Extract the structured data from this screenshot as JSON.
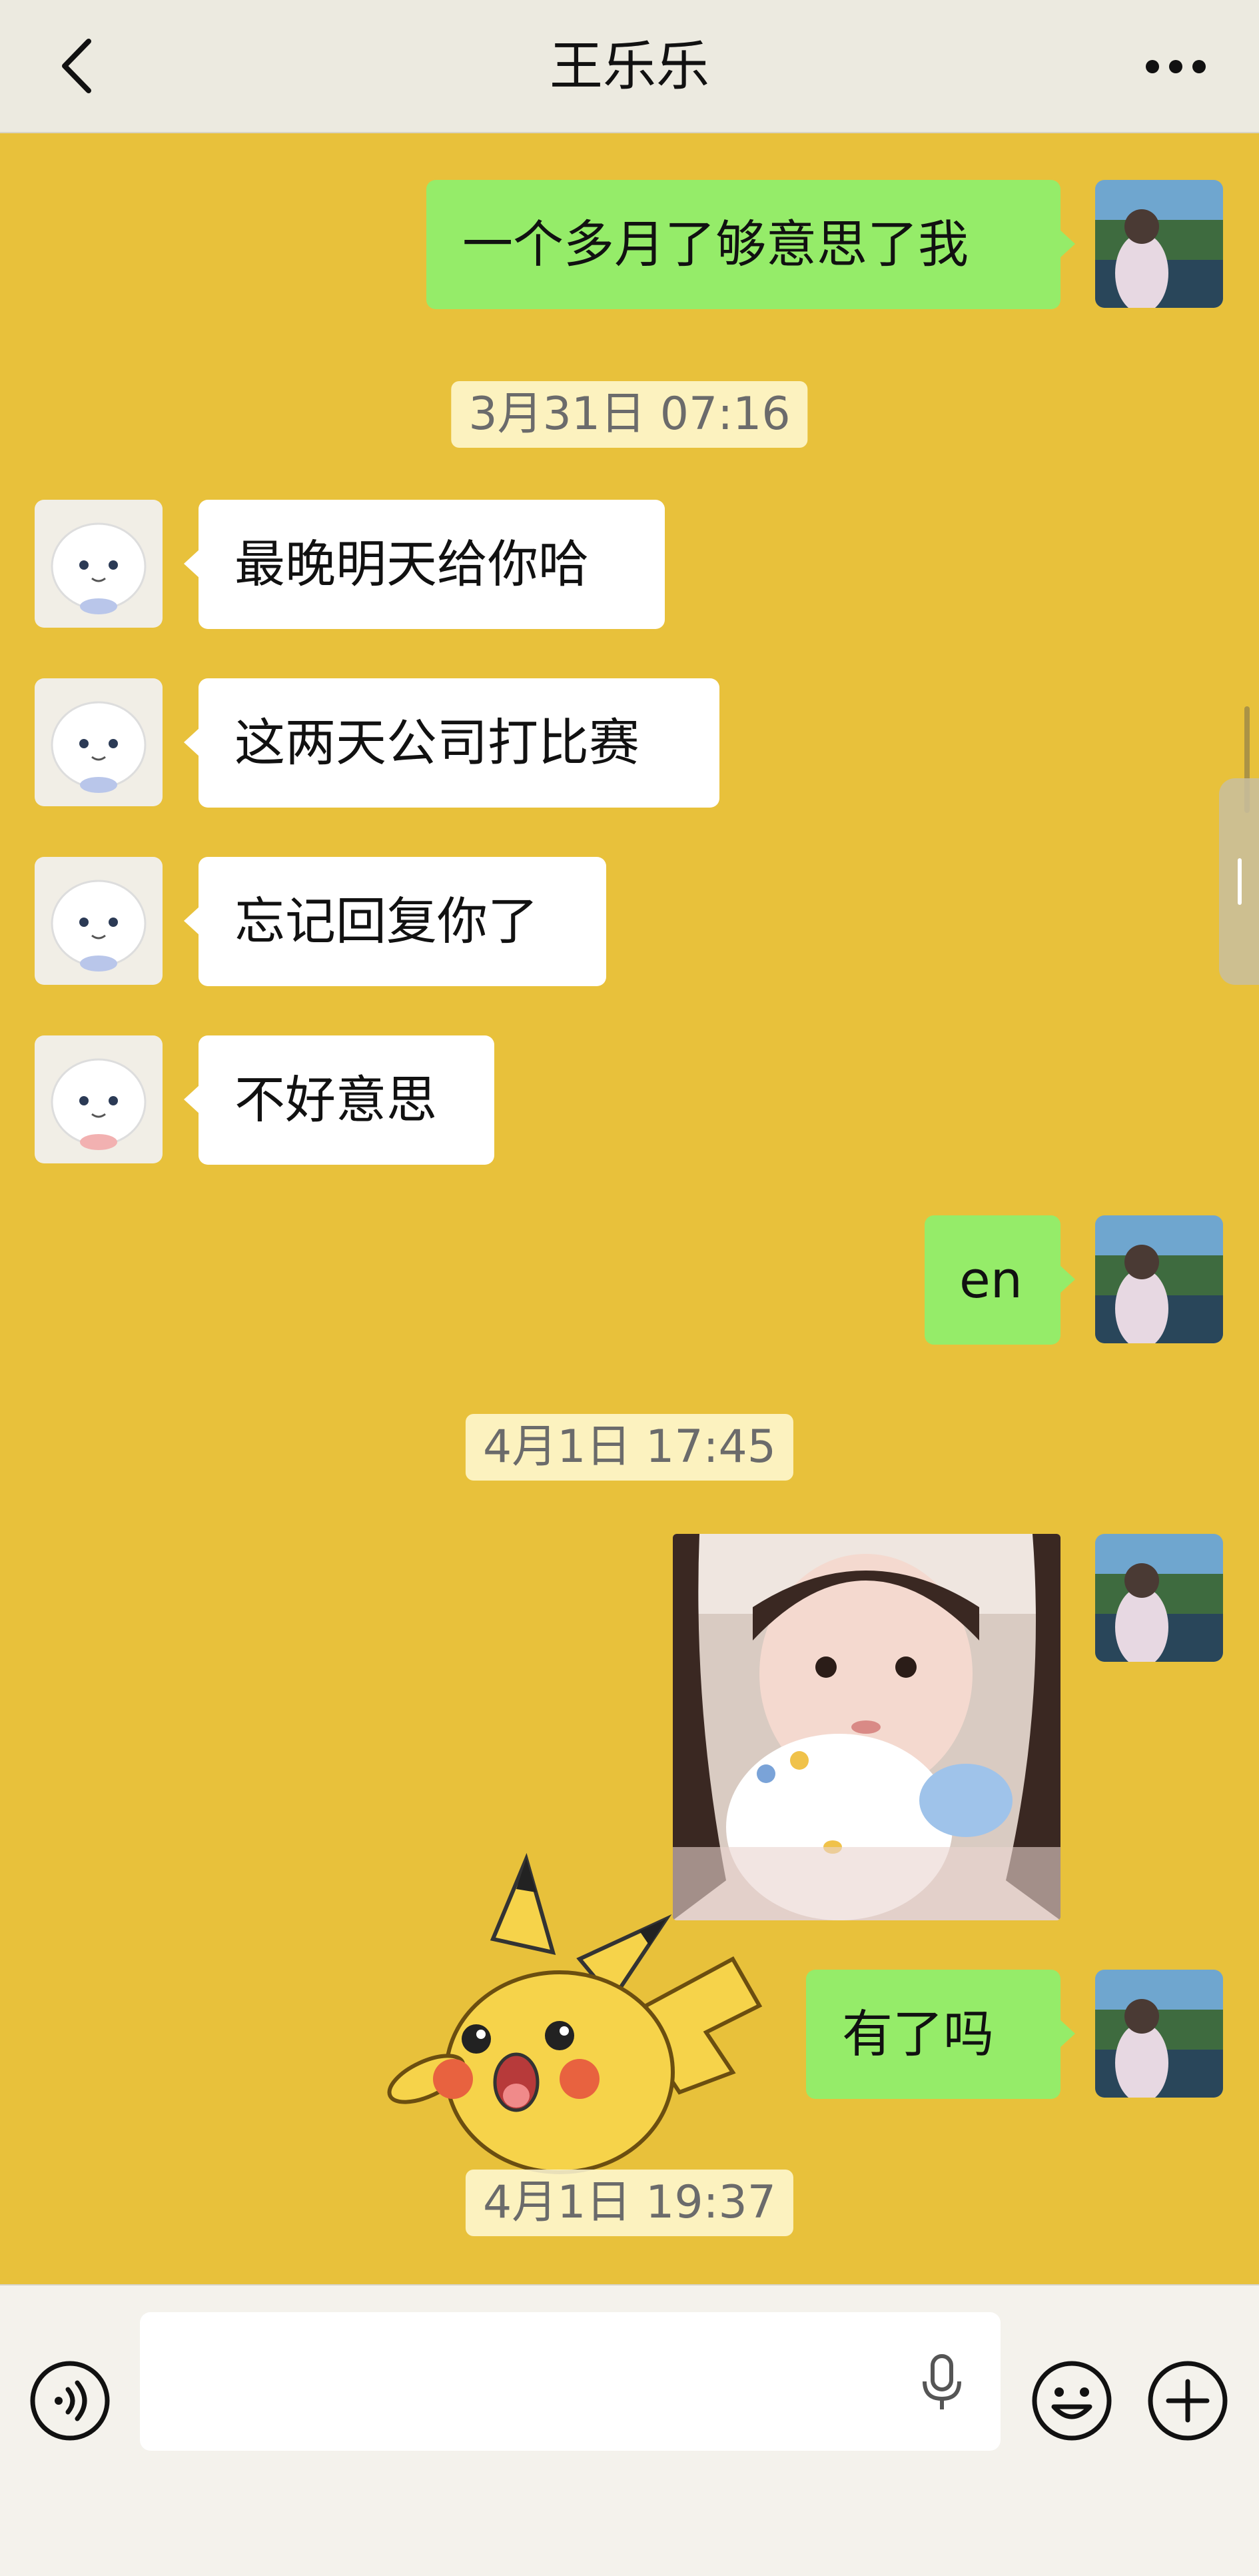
{
  "header": {
    "title": "王乐乐",
    "back_icon": "chevron-left-icon",
    "more_icon": "more-dots-icon"
  },
  "messages": [
    {
      "direction": "out",
      "text": "一个多月了够意思了我"
    },
    {
      "timestamp": "3月31日 07:16"
    },
    {
      "direction": "in",
      "text": "最晚明天给你哈"
    },
    {
      "direction": "in",
      "text": "这两天公司打比赛"
    },
    {
      "direction": "in",
      "text": "忘记回复你了"
    },
    {
      "direction": "in",
      "text": "不好意思"
    },
    {
      "direction": "out",
      "text": "en"
    },
    {
      "timestamp": "4月1日 17:45"
    },
    {
      "direction": "out",
      "type": "image"
    },
    {
      "direction": "out",
      "text": "有了吗"
    },
    {
      "timestamp": "4月1日 19:37"
    }
  ],
  "input_bar": {
    "voice_icon": "voice-icon",
    "mic_icon": "microphone-icon",
    "emoji_icon": "emoji-icon",
    "plus_icon": "plus-icon"
  },
  "colors": {
    "chat_background": "#e8c13b",
    "outgoing_bubble": "#95ec69",
    "incoming_bubble": "#ffffff",
    "topbar": "#eceae0"
  }
}
